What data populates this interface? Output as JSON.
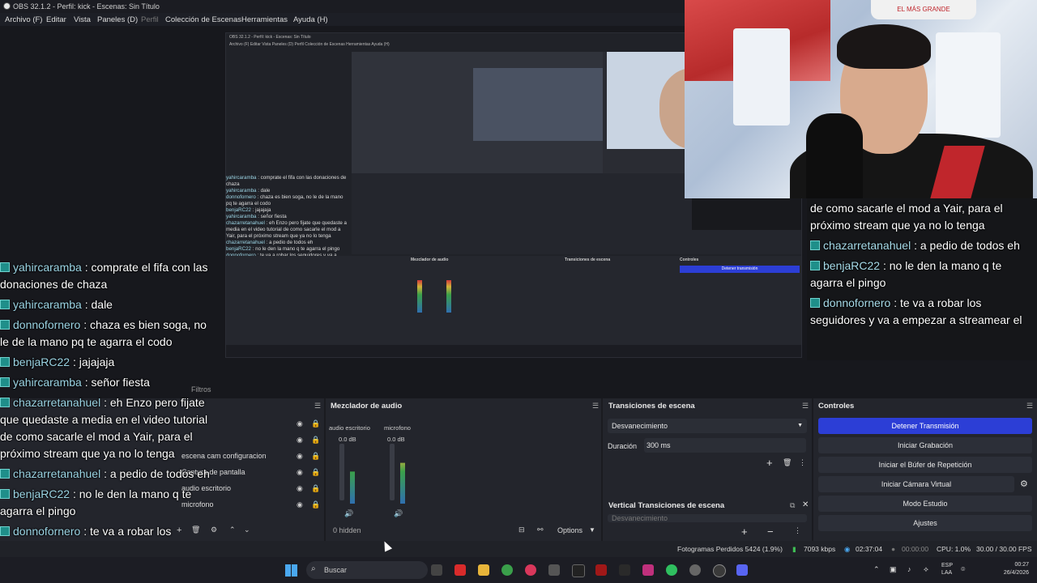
{
  "window": {
    "title": "OBS 32.1.2 - Perfil: kick - Escenas: Sin Título"
  },
  "menu": [
    "Archivo (F)",
    "Editar",
    "Vista",
    "Paneles (D)",
    "Perfil",
    "Colección de Escenas",
    "Herramientas",
    "Ayuda (H)"
  ],
  "nested": {
    "title": "OBS 32.1.2 - Perfil: kick - Escenas: Sin Título",
    "menu": "Archivo (F)  Editar  Vista  Paneles (D)  Perfil  Colección de Escenas  Herramientas  Ayuda (H)",
    "chat": [
      {
        "user": "yahircaramba",
        "text": ": comprate el fifa con las donaciones de chaza"
      },
      {
        "user": "yahircaramba",
        "text": ": dale"
      },
      {
        "user": "donnofornero",
        "text": ": chaza es bien soga, no le de la mano pq te agarra el codo"
      },
      {
        "user": "benjaRC22",
        "text": ": jajajaja"
      },
      {
        "user": "yahircaramba",
        "text": ": señor fiesta"
      },
      {
        "user": "chazarretanahuel",
        "text": ": eh Enzo pero fijate que quedaste a media en el video tutorial de como sacarle el mod a Yair, para el próximo stream que ya no lo tenga"
      },
      {
        "user": "chazarretanahuel",
        "text": ": a pedio de todos eh"
      },
      {
        "user": "benjaRC22",
        "text": ": no le den la mano q te agarra el pingo"
      },
      {
        "user": "donnofornero",
        "text": ": te va a robar los seguidores y va a empezar a streamear el"
      }
    ],
    "docks": [
      "Mezclador de audio",
      "Transiciones de escena",
      "Controles"
    ],
    "stop_label": "Detener transmisión"
  },
  "webcam": {
    "sign": "EL MÁS GRANDE"
  },
  "right_chat": [
    {
      "user": "",
      "text": "de como sacarle el mod a Yair, para el próximo stream que ya no lo tenga"
    },
    {
      "user": "chazarretanahuel",
      "text": ": a pedio de todos eh"
    },
    {
      "user": "benjaRC22",
      "text": ": no le den la mano q te agarra el pingo"
    },
    {
      "user": "donnofornero",
      "text": ": te va a robar los seguidores y va a empezar a streamear el"
    }
  ],
  "left_chat": [
    {
      "user": "yahircaramba",
      "text": ": comprate el fifa con las donaciones de chaza"
    },
    {
      "user": "yahircaramba",
      "text": ": dale"
    },
    {
      "user": "donnofornero",
      "text": ": chaza es bien soga, no le de la mano pq te agarra el codo"
    },
    {
      "user": "benjaRC22",
      "text": ": jajajaja"
    },
    {
      "user": "yahircaramba",
      "text": ": señor fiesta"
    },
    {
      "user": "chazarretanahuel",
      "text": ": eh Enzo pero fijate que quedaste a media en el video tutorial de como sacarle el mod a Yair, para el próximo stream que ya no lo tenga"
    },
    {
      "user": "chazarretanahuel",
      "text": ": a pedio de todos eh"
    },
    {
      "user": "benjaRC22",
      "text": ": no le den la mano q te agarra el pingo"
    },
    {
      "user": "donnofornero",
      "text": ": te va a robar los seguidores y va a empezar a streamear el"
    }
  ],
  "sources": {
    "filters_label": "Filtros",
    "items": [
      "escena cam configuracion",
      "Captura de pantalla",
      "audio escritorio",
      "microfono"
    ]
  },
  "mixer": {
    "title": "Mezclador de audio",
    "channels": [
      {
        "name": "audio escritorio",
        "db": "0.0 dB",
        "level": 0.55
      },
      {
        "name": "microfono",
        "db": "0.0 dB",
        "level": 0.7
      }
    ],
    "hidden": "0 hidden",
    "options": "Options"
  },
  "transitions": {
    "title": "Transiciones de escena",
    "selected": "Desvanecimiento",
    "duration_label": "Duración",
    "duration_value": "300 ms",
    "vertical_title": "Vertical Transiciones de escena",
    "vertical_selected": "Desvanecimiento"
  },
  "controls": {
    "title": "Controles",
    "buttons": [
      "Detener Transmisión",
      "Iniciar Grabación",
      "Iniciar el Búfer de Repetición",
      "Iniciar Cámara Virtual",
      "Modo Estudio",
      "Ajustes"
    ]
  },
  "status": {
    "dropped": "Fotogramas Perdidos 5424 (1.9%)",
    "bitrate": "7093 kbps",
    "stream_time": "02:37:04",
    "rec_time": "00:00:00",
    "cpu": "CPU: 1.0%",
    "fps": "30.00 / 30.00 FPS"
  },
  "taskbar": {
    "search": "Buscar",
    "lang": "ESP",
    "layout": "LAA",
    "time": "00:27",
    "date": "26/4/2026"
  },
  "colors": {
    "accent": "#2c3ed6",
    "chat_user": "#9bd4e4",
    "badge": "#1f8f8a"
  }
}
